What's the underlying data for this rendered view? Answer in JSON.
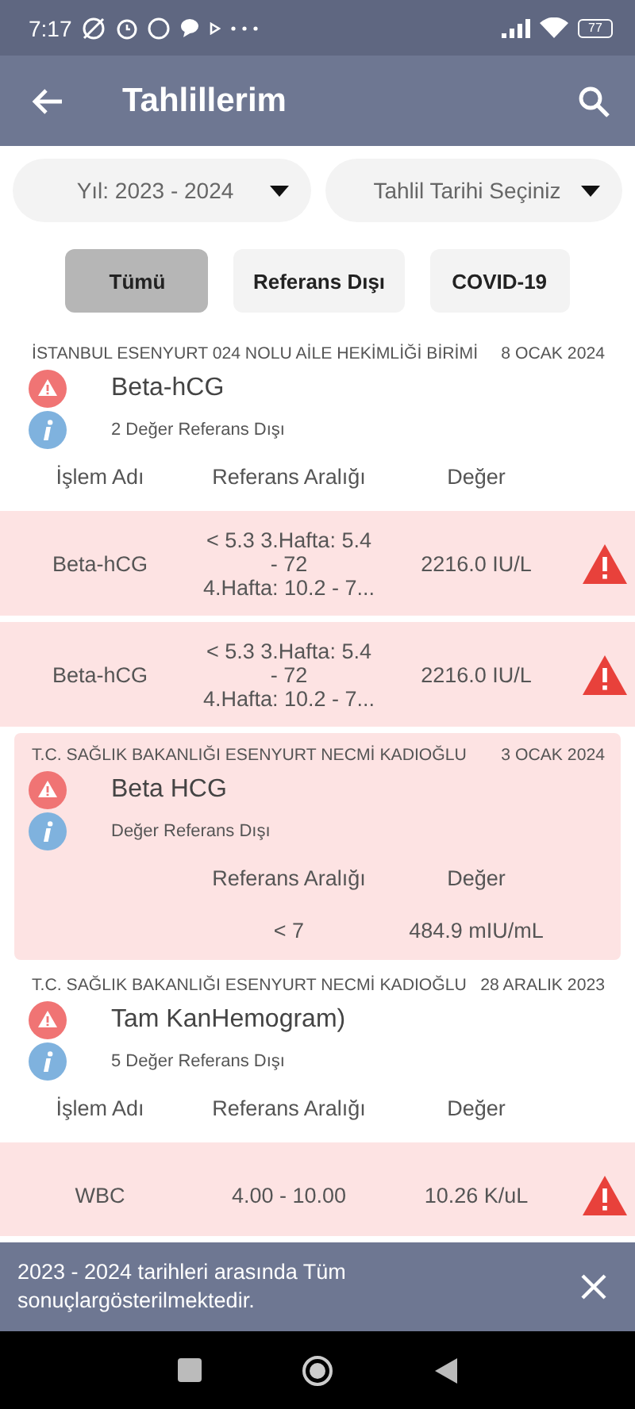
{
  "status_bar": {
    "time": "7:17",
    "battery": "77"
  },
  "app_bar": {
    "title": "Tahlillerim"
  },
  "filters": [
    {
      "label": "Yıl: 2023 - 2024"
    },
    {
      "label": "Tahlil Tarihi Seçiniz"
    }
  ],
  "chips": [
    {
      "label": "Tümü",
      "selected": true
    },
    {
      "label": "Referans Dışı",
      "selected": false
    },
    {
      "label": "COVID-19",
      "selected": false
    }
  ],
  "groups": [
    {
      "institution": "İSTANBUL ESENYURT 024 NOLU AİLE HEKİMLİĞİ BİRİMİ",
      "date": "8 OCAK 2024",
      "title": "Beta-hCG",
      "summary": "2 Değer Referans Dışı",
      "highlighted": false,
      "columns": [
        {
          "kind": "name",
          "label": "İşlem Adı"
        },
        {
          "kind": "range",
          "label": "Referans Aralığı"
        },
        {
          "kind": "value",
          "label": "Değer"
        }
      ],
      "rows": [
        {
          "name": "Beta-hCG",
          "range": "< 5.3  3.Hafta: 5.4\n- 72\n4.Hafta: 10.2 - 7...",
          "value": "2216.0 IU/L",
          "out_of_range": true
        },
        {
          "name": "Beta-hCG",
          "range": "< 5.3  3.Hafta: 5.4\n- 72\n4.Hafta: 10.2 - 7...",
          "value": "2216.0 IU/L",
          "out_of_range": true
        }
      ]
    },
    {
      "institution": "T.C. SAĞLIK BAKANLIĞI ESENYURT NECMİ KADIOĞLU",
      "date": "3 OCAK 2024",
      "title": "Beta HCG",
      "summary": "Değer Referans Dışı",
      "highlighted": true,
      "columns": [
        {
          "kind": "range",
          "label": "Referans Aralığı"
        },
        {
          "kind": "value",
          "label": "Değer"
        }
      ],
      "rows": [
        {
          "range": "< 7",
          "value": "484.9 mIU/mL",
          "out_of_range": false
        }
      ]
    },
    {
      "institution": "T.C. SAĞLIK BAKANLIĞI ESENYURT NECMİ KADIOĞLU",
      "date": "28 ARALIK 2023",
      "title": "Tam KanHemogram)",
      "summary": "5 Değer Referans Dışı",
      "highlighted": false,
      "columns": [
        {
          "kind": "name",
          "label": "İşlem Adı"
        },
        {
          "kind": "range",
          "label": "Referans Aralığı"
        },
        {
          "kind": "value",
          "label": "Değer"
        }
      ],
      "rows": [
        {
          "name": "WBC",
          "range": "4.00 - 10.00",
          "value": "10.26 K/uL",
          "out_of_range": true
        }
      ]
    }
  ],
  "snackbar": {
    "message": "2023 - 2024 tarihleri arasında Tüm sonuçlargösterilmektedir."
  }
}
